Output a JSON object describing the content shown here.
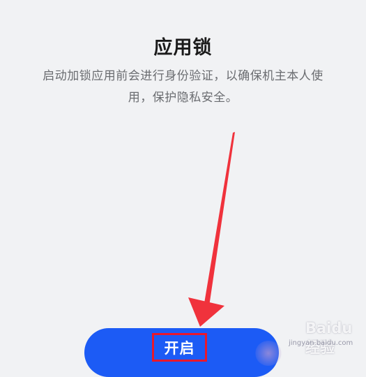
{
  "app_lock": {
    "title": "应用锁",
    "description": "启动加锁应用前会进行身份验证，以确保机主本人使用，保护隐私安全。",
    "enable_label": "开启"
  },
  "annotations": {
    "arrow_color": "#f0323c",
    "highlight_color": "#e8182c"
  },
  "watermark": {
    "brand": "Baidu经验",
    "url": "jingyan.baidu.com"
  },
  "colors": {
    "background": "#f1f2f4",
    "button": "#1c5bf5",
    "title": "#1b1b1b",
    "description": "#6a6c70"
  }
}
